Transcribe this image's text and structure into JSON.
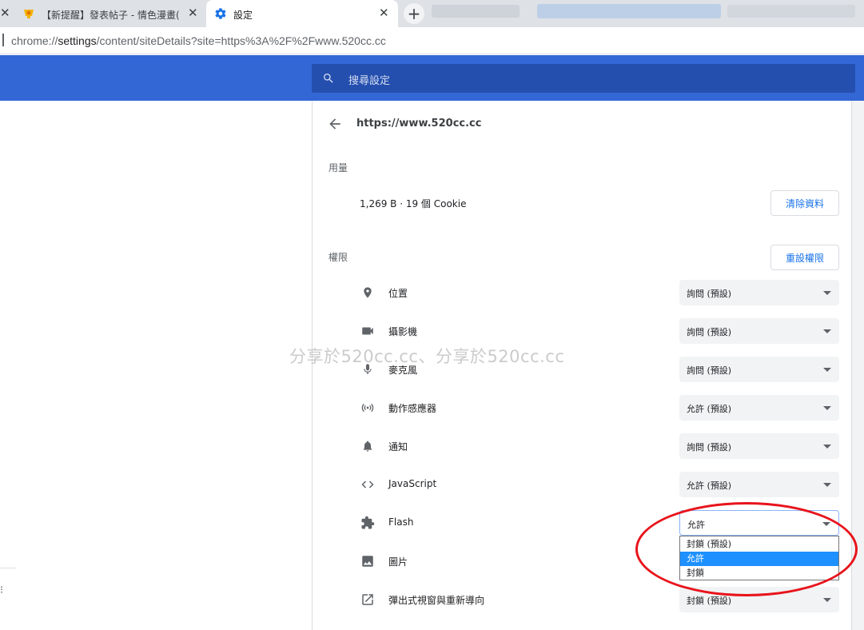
{
  "tabs": [
    {
      "title": "【新提醒】發表帖子 - 情色漫畫(",
      "icon": "site-favicon",
      "active": false
    },
    {
      "title": "設定",
      "icon": "gear-icon",
      "active": true
    }
  ],
  "omnibox": {
    "scheme": "chrome://",
    "host": "settings",
    "path": "/content/siteDetails?site=https%3A%2F%2Fwww.520cc.cc"
  },
  "search": {
    "placeholder": "搜尋設定"
  },
  "site": {
    "url": "https://www.520cc.cc"
  },
  "usage": {
    "section_label": "用量",
    "summary": "1,269 B · 19 個 Cookie",
    "clear_button": "清除資料"
  },
  "permissions": {
    "section_label": "權限",
    "reset_button": "重設權限",
    "items": [
      {
        "label": "位置",
        "icon": "location-pin-icon",
        "value": "詢問 (預設)"
      },
      {
        "label": "攝影機",
        "icon": "camera-icon",
        "value": "詢問 (預設)"
      },
      {
        "label": "麥克風",
        "icon": "microphone-icon",
        "value": "詢問 (預設)"
      },
      {
        "label": "動作感應器",
        "icon": "sensor-icon",
        "value": "允許 (預設)"
      },
      {
        "label": "通知",
        "icon": "bell-icon",
        "value": "詢問 (預設)"
      },
      {
        "label": "JavaScript",
        "icon": "code-icon",
        "value": "允許 (預設)"
      },
      {
        "label": "Flash",
        "icon": "puzzle-icon",
        "value": "允許"
      },
      {
        "label": "圖片",
        "icon": "image-icon",
        "value": ""
      },
      {
        "label": "彈出式視窗與重新導向",
        "icon": "open-in-new-icon",
        "value": "封鎖 (預設)"
      }
    ]
  },
  "dropdown": {
    "options": [
      "封鎖 (預設)",
      "允許",
      "封鎖"
    ],
    "selected": "允許"
  },
  "watermark": "分享於520cc.cc、分享於520cc.cc",
  "colors": {
    "header": "#3367d6",
    "search": "#254fae",
    "accent": "#1a73e8",
    "annotation": "#e8141c"
  }
}
